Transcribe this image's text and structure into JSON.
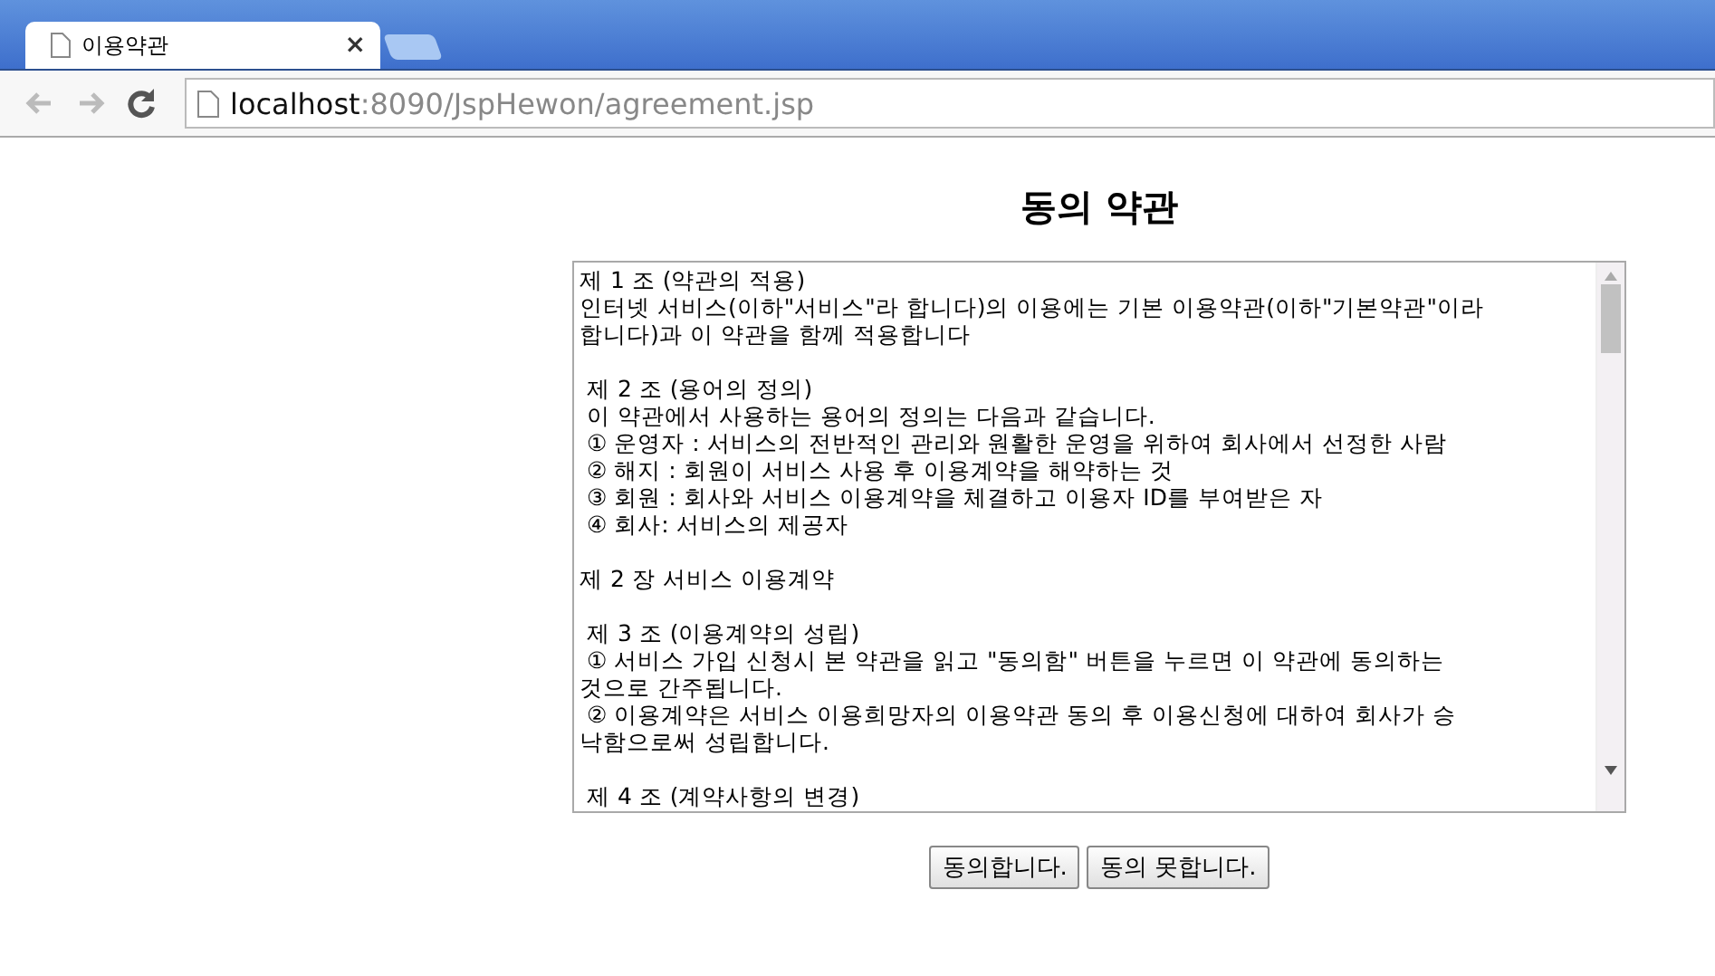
{
  "browser": {
    "tab": {
      "title": "이용약관",
      "close": "×"
    },
    "address": {
      "host": "localhost",
      "path": ":8090/JspHewon/agreement.jsp"
    }
  },
  "page": {
    "heading": "동의 약관",
    "terms": [
      [
        "제 1 조 (약관의 적용)",
        "인터넷 서비스(이하\"서비스\"라 합니다)의 이용에는 기본 이용약관(이하\"기본약관\"이라",
        "합니다)과 이 약관을 함께 적용합니다"
      ],
      [
        " 제 2 조 (용어의 정의)",
        " 이 약관에서 사용하는 용어의 정의는 다음과 같습니다.",
        " ① 운영자 : 서비스의 전반적인 관리와 원활한 운영을 위하여 회사에서 선정한 사람",
        " ② 해지 : 회원이 서비스 사용 후 이용계약을 해약하는 것",
        " ③ 회원 : 회사와 서비스 이용계약을 체결하고 이용자 ID를 부여받은 자",
        " ④ 회사: 서비스의 제공자"
      ],
      [
        "제 2 장 서비스 이용계약"
      ],
      [
        " 제 3 조 (이용계약의 성립)",
        " ① 서비스 가입 신청시 본 약관을 읽고 \"동의함\" 버튼을 누르면 이 약관에 동의하는",
        "것으로 간주됩니다.",
        " ② 이용계약은 서비스 이용희망자의 이용약관 동의 후 이용신청에 대하여 회사가 승",
        "낙함으로써 성립합니다."
      ],
      [
        " 제 4 조 (계약사항의 변경)"
      ]
    ],
    "buttons": [
      "동의합니다.",
      "동의 못합니다."
    ]
  }
}
